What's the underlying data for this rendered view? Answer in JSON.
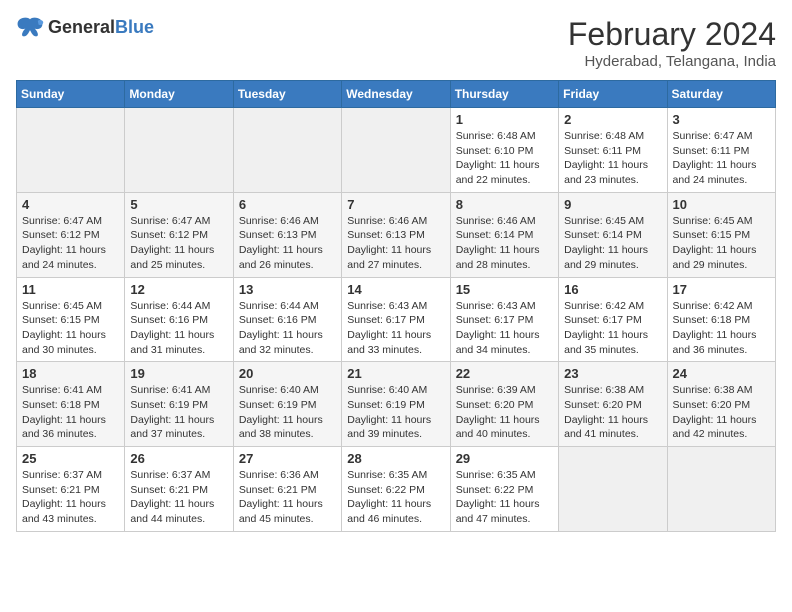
{
  "header": {
    "logo_general": "General",
    "logo_blue": "Blue",
    "title": "February 2024",
    "subtitle": "Hyderabad, Telangana, India"
  },
  "weekdays": [
    "Sunday",
    "Monday",
    "Tuesday",
    "Wednesday",
    "Thursday",
    "Friday",
    "Saturday"
  ],
  "weeks": [
    [
      {
        "day": "",
        "info": ""
      },
      {
        "day": "",
        "info": ""
      },
      {
        "day": "",
        "info": ""
      },
      {
        "day": "",
        "info": ""
      },
      {
        "day": "1",
        "info": "Sunrise: 6:48 AM\nSunset: 6:10 PM\nDaylight: 11 hours and 22 minutes."
      },
      {
        "day": "2",
        "info": "Sunrise: 6:48 AM\nSunset: 6:11 PM\nDaylight: 11 hours and 23 minutes."
      },
      {
        "day": "3",
        "info": "Sunrise: 6:47 AM\nSunset: 6:11 PM\nDaylight: 11 hours and 24 minutes."
      }
    ],
    [
      {
        "day": "4",
        "info": "Sunrise: 6:47 AM\nSunset: 6:12 PM\nDaylight: 11 hours and 24 minutes."
      },
      {
        "day": "5",
        "info": "Sunrise: 6:47 AM\nSunset: 6:12 PM\nDaylight: 11 hours and 25 minutes."
      },
      {
        "day": "6",
        "info": "Sunrise: 6:46 AM\nSunset: 6:13 PM\nDaylight: 11 hours and 26 minutes."
      },
      {
        "day": "7",
        "info": "Sunrise: 6:46 AM\nSunset: 6:13 PM\nDaylight: 11 hours and 27 minutes."
      },
      {
        "day": "8",
        "info": "Sunrise: 6:46 AM\nSunset: 6:14 PM\nDaylight: 11 hours and 28 minutes."
      },
      {
        "day": "9",
        "info": "Sunrise: 6:45 AM\nSunset: 6:14 PM\nDaylight: 11 hours and 29 minutes."
      },
      {
        "day": "10",
        "info": "Sunrise: 6:45 AM\nSunset: 6:15 PM\nDaylight: 11 hours and 29 minutes."
      }
    ],
    [
      {
        "day": "11",
        "info": "Sunrise: 6:45 AM\nSunset: 6:15 PM\nDaylight: 11 hours and 30 minutes."
      },
      {
        "day": "12",
        "info": "Sunrise: 6:44 AM\nSunset: 6:16 PM\nDaylight: 11 hours and 31 minutes."
      },
      {
        "day": "13",
        "info": "Sunrise: 6:44 AM\nSunset: 6:16 PM\nDaylight: 11 hours and 32 minutes."
      },
      {
        "day": "14",
        "info": "Sunrise: 6:43 AM\nSunset: 6:17 PM\nDaylight: 11 hours and 33 minutes."
      },
      {
        "day": "15",
        "info": "Sunrise: 6:43 AM\nSunset: 6:17 PM\nDaylight: 11 hours and 34 minutes."
      },
      {
        "day": "16",
        "info": "Sunrise: 6:42 AM\nSunset: 6:17 PM\nDaylight: 11 hours and 35 minutes."
      },
      {
        "day": "17",
        "info": "Sunrise: 6:42 AM\nSunset: 6:18 PM\nDaylight: 11 hours and 36 minutes."
      }
    ],
    [
      {
        "day": "18",
        "info": "Sunrise: 6:41 AM\nSunset: 6:18 PM\nDaylight: 11 hours and 36 minutes."
      },
      {
        "day": "19",
        "info": "Sunrise: 6:41 AM\nSunset: 6:19 PM\nDaylight: 11 hours and 37 minutes."
      },
      {
        "day": "20",
        "info": "Sunrise: 6:40 AM\nSunset: 6:19 PM\nDaylight: 11 hours and 38 minutes."
      },
      {
        "day": "21",
        "info": "Sunrise: 6:40 AM\nSunset: 6:19 PM\nDaylight: 11 hours and 39 minutes."
      },
      {
        "day": "22",
        "info": "Sunrise: 6:39 AM\nSunset: 6:20 PM\nDaylight: 11 hours and 40 minutes."
      },
      {
        "day": "23",
        "info": "Sunrise: 6:38 AM\nSunset: 6:20 PM\nDaylight: 11 hours and 41 minutes."
      },
      {
        "day": "24",
        "info": "Sunrise: 6:38 AM\nSunset: 6:20 PM\nDaylight: 11 hours and 42 minutes."
      }
    ],
    [
      {
        "day": "25",
        "info": "Sunrise: 6:37 AM\nSunset: 6:21 PM\nDaylight: 11 hours and 43 minutes."
      },
      {
        "day": "26",
        "info": "Sunrise: 6:37 AM\nSunset: 6:21 PM\nDaylight: 11 hours and 44 minutes."
      },
      {
        "day": "27",
        "info": "Sunrise: 6:36 AM\nSunset: 6:21 PM\nDaylight: 11 hours and 45 minutes."
      },
      {
        "day": "28",
        "info": "Sunrise: 6:35 AM\nSunset: 6:22 PM\nDaylight: 11 hours and 46 minutes."
      },
      {
        "day": "29",
        "info": "Sunrise: 6:35 AM\nSunset: 6:22 PM\nDaylight: 11 hours and 47 minutes."
      },
      {
        "day": "",
        "info": ""
      },
      {
        "day": "",
        "info": ""
      }
    ]
  ]
}
